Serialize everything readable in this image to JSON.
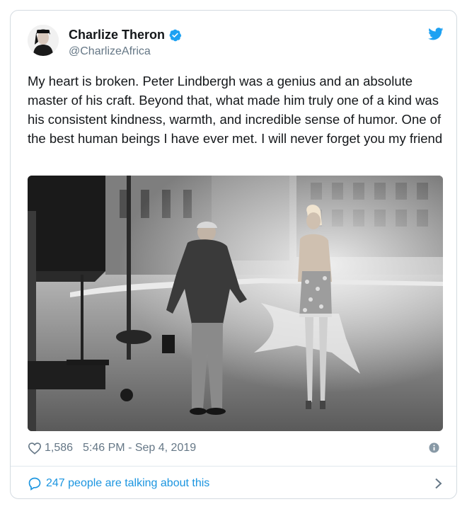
{
  "author": {
    "name": "Charlize Theron",
    "handle": "@CharlizeAfrica",
    "verified": true
  },
  "tweet": {
    "text": "My heart is broken. Peter Lindbergh was a genius and an absolute master of his craft. Beyond that, what made him truly one of a kind was his consistent kindness, warmth, and incredible sense of humor. One of the best human beings I have ever met. I will never forget you my friend"
  },
  "media": {
    "description_icon": "black-and-white-photo"
  },
  "meta": {
    "likes": "1,586",
    "timestamp": "5:46 PM - Sep 4, 2019"
  },
  "footer": {
    "talking": "247 people are talking about this"
  },
  "colors": {
    "twitter_blue": "#1da1f2",
    "link_blue": "#1b95e0",
    "secondary_text": "#657786",
    "border": "#d4dbe1"
  }
}
